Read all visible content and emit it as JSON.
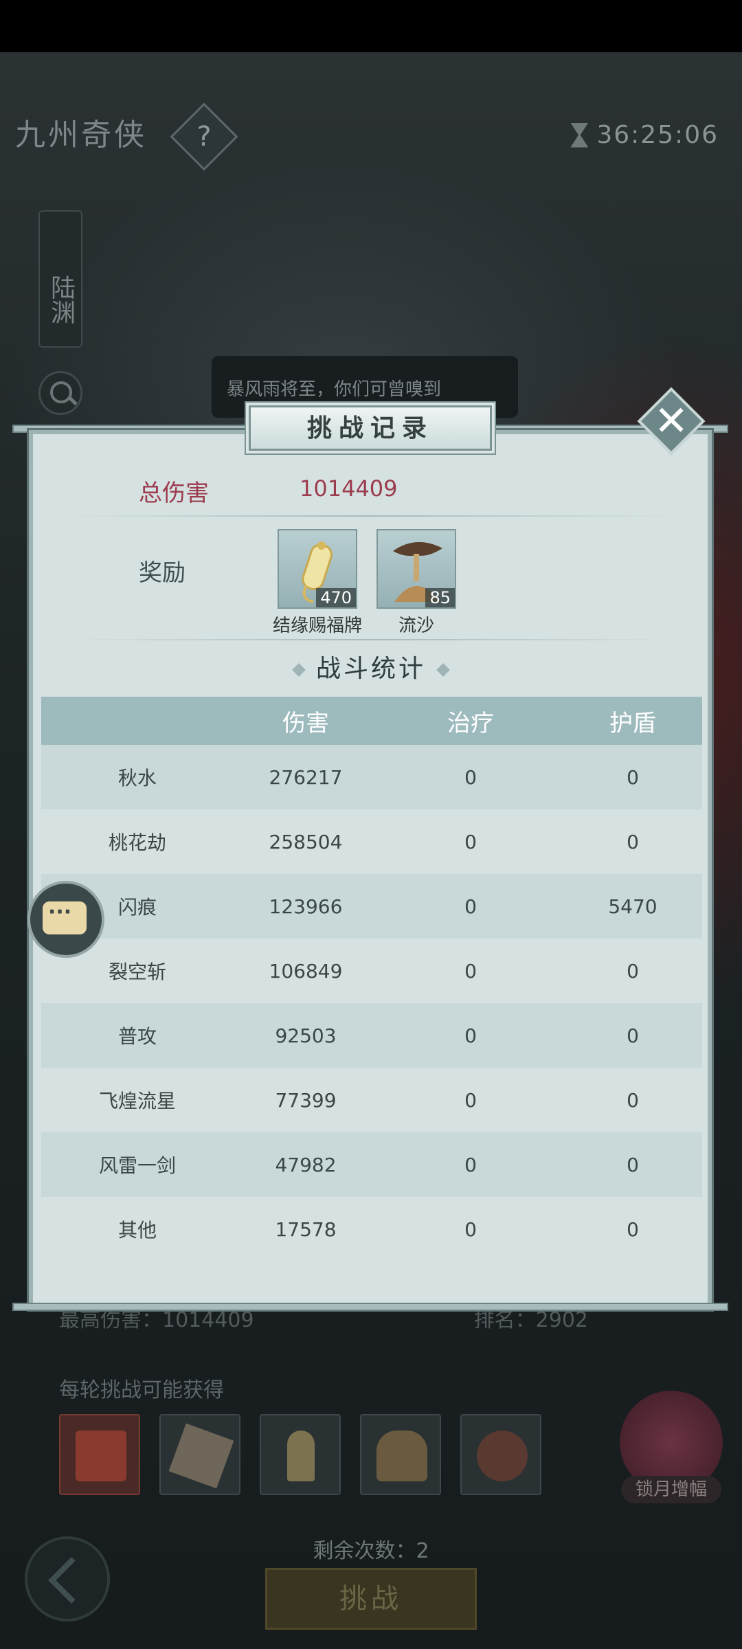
{
  "background": {
    "game_title": "九州奇侠",
    "help_label": "?",
    "timer": "36:25:06",
    "side_name": "陆渊",
    "npc_speech": "暴风雨将至，你们可曾嗅到",
    "best_damage_label": "最高伤害：",
    "best_damage_value": "1014409",
    "rank_label": "排名：",
    "rank_value": "2902",
    "each_round_label": "每轮挑战可能获得",
    "lock_moon_label": "锁月增幅",
    "remaining_label": "剩余次数：",
    "remaining_value": "2",
    "challenge_button": "挑战"
  },
  "modal": {
    "title": "挑战记录",
    "close_label": "✕",
    "total_damage_label": "总伤害",
    "total_damage_value": "1014409",
    "reward_label": "奖励",
    "rewards": [
      {
        "name": "结缘赐福牌",
        "qty": "470"
      },
      {
        "name": "流沙",
        "qty": "85"
      }
    ],
    "stats_header": "战斗统计",
    "table": {
      "columns": [
        "",
        "伤害",
        "治疗",
        "护盾"
      ],
      "rows": [
        [
          "秋水",
          "276217",
          "0",
          "0"
        ],
        [
          "桃花劫",
          "258504",
          "0",
          "0"
        ],
        [
          "闪痕",
          "123966",
          "0",
          "5470"
        ],
        [
          "裂空斩",
          "106849",
          "0",
          "0"
        ],
        [
          "普攻",
          "92503",
          "0",
          "0"
        ],
        [
          "飞煌流星",
          "77399",
          "0",
          "0"
        ],
        [
          "风雷一剑",
          "47982",
          "0",
          "0"
        ],
        [
          "其他",
          "17578",
          "0",
          "0"
        ]
      ]
    }
  },
  "colors": {
    "modal_bg": "#d6e2e2",
    "header_bg": "#9dbabd",
    "accent_red": "#9c3b4e"
  }
}
